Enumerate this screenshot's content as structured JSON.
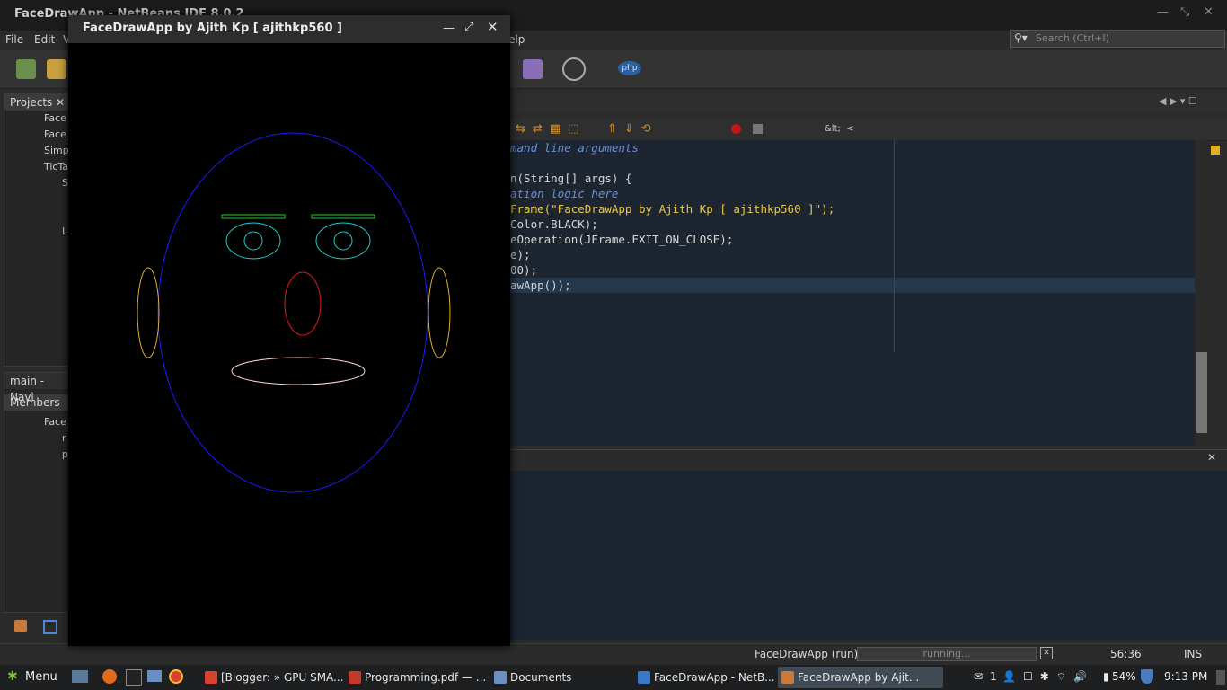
{
  "ide": {
    "window_title": "FaceDrawApp - NetBeans IDE 8.0.2",
    "menus": [
      "File",
      "Edit",
      "V",
      "elp"
    ],
    "search_placeholder": "Search (Ctrl+I)"
  },
  "projects_panel": {
    "tab": "Projects",
    "items": [
      "Face",
      "Face",
      "Simp",
      "TicTa",
      "S",
      "L"
    ]
  },
  "navigator_panel": {
    "title": "main - Navi",
    "tab": "Members",
    "items": [
      "Face",
      "r",
      "p"
    ]
  },
  "editor": {
    "lines": [
      {
        "text": "mand line arguments",
        "kind": "comment"
      },
      {
        "text": "",
        "kind": "code"
      },
      {
        "text": "n(String[] args) {",
        "kind": "code"
      },
      {
        "text": "ation logic here",
        "kind": "comment"
      },
      {
        "text": "Frame(\"FaceDrawApp by Ajith Kp [ ajithkp560 ]\");",
        "kind": "string"
      },
      {
        "text": "Color.BLACK);",
        "kind": "code"
      },
      {
        "text": "eOperation(JFrame.EXIT_ON_CLOSE);",
        "kind": "code"
      },
      {
        "text": "e);",
        "kind": "code"
      },
      {
        "text": "00);",
        "kind": "code"
      },
      {
        "text": "awApp());",
        "kind": "code"
      }
    ]
  },
  "statusbar": {
    "task": "FaceDrawApp (run)",
    "progress_text": "running...",
    "position": "56:36",
    "mode": "INS"
  },
  "app_window": {
    "title": "FaceDrawApp by Ajith Kp [ ajithkp560 ]"
  },
  "taskbar": {
    "menu_label": "Menu",
    "tasks": [
      "[Blogger: » GPU SMA...",
      "Programming.pdf — ...",
      "Documents",
      "FaceDrawApp - NetB...",
      "FaceDrawApp by Ajit..."
    ],
    "battery": "54%",
    "time": "9:13 PM",
    "notification_count": "1"
  },
  "colors": {
    "face_outline": "#1a1aff",
    "eyebrows": "#22cc22",
    "eyes": "#22cccc",
    "nose": "#e01a1a",
    "ears": "#e0b020",
    "mouth": "#ffd8d0"
  }
}
